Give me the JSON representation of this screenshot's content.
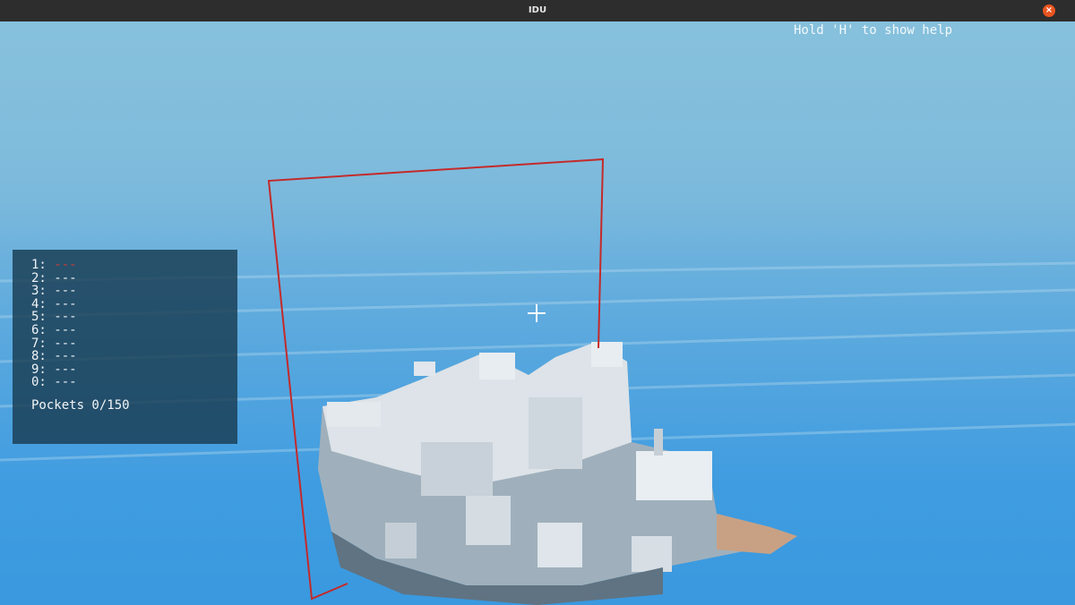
{
  "window": {
    "title": "IDU"
  },
  "hud": {
    "help_hint": "Hold 'H' to show help",
    "slots": [
      {
        "key": "1:",
        "value": "---",
        "active": true
      },
      {
        "key": "2:",
        "value": "---"
      },
      {
        "key": "3:",
        "value": "---"
      },
      {
        "key": "4:",
        "value": "---"
      },
      {
        "key": "5:",
        "value": "---"
      },
      {
        "key": "6:",
        "value": "---"
      },
      {
        "key": "7:",
        "value": "---"
      },
      {
        "key": "8:",
        "value": "---"
      },
      {
        "key": "9:",
        "value": "---"
      },
      {
        "key": "0:",
        "value": "---"
      }
    ],
    "pockets": "Pockets 0/150"
  },
  "colors": {
    "sky": "#82bedc",
    "water": "#3a99df",
    "selection_outline": "#c42a2a",
    "active_slot": "#d23a3a",
    "rock": "#d4dde4"
  }
}
